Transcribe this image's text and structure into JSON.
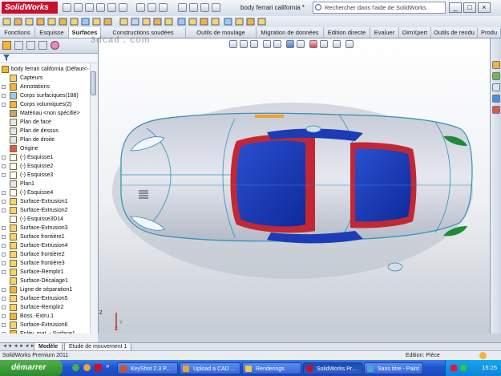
{
  "app": {
    "logo_text": "SolidWorks",
    "document_title": "body ferrari california *",
    "search_placeholder": "Rechercher dans l'aide de SolidWorks",
    "watermark": "3dcad . com",
    "accent_color": "#c8102e"
  },
  "window_buttons": [
    "_",
    "□",
    "×"
  ],
  "command_tabs": [
    {
      "label": "Fonctions",
      "active": false
    },
    {
      "label": "Esquisse",
      "active": false
    },
    {
      "label": "Surfaces",
      "active": true
    },
    {
      "label": "Constructions soudées",
      "active": false
    },
    {
      "label": "Outils de moulage",
      "active": false
    },
    {
      "label": "Migration de données",
      "active": false
    },
    {
      "label": "Edition directe",
      "active": false
    },
    {
      "label": "Evaluer",
      "active": false
    },
    {
      "label": "DimXpert",
      "active": false
    },
    {
      "label": "Outils de rendu",
      "active": false
    },
    {
      "label": "Produ",
      "active": false
    }
  ],
  "feature_tree": {
    "root_label": "body ferrari california  (Défaut<-",
    "items": [
      {
        "label": "Capteurs",
        "icon": "sensor-icon",
        "expandable": false
      },
      {
        "label": "Annotations",
        "icon": "annotation-icon",
        "expandable": true
      },
      {
        "label": "Corps surfaciques(188)",
        "icon": "surface-body-icon",
        "expandable": true
      },
      {
        "label": "Corps volumiques(2)",
        "icon": "solid-body-icon",
        "expandable": true
      },
      {
        "label": "Matériau <non spécifié>",
        "icon": "material-icon",
        "expandable": false
      },
      {
        "label": "Plan de face",
        "icon": "plane-icon",
        "expandable": false
      },
      {
        "label": "Plan de dessus",
        "icon": "plane-icon",
        "expandable": false
      },
      {
        "label": "Plan de droite",
        "icon": "plane-icon",
        "expandable": false
      },
      {
        "label": "Origine",
        "icon": "origin-icon",
        "expandable": false
      },
      {
        "label": "(-) Esquisse1",
        "icon": "sketch-icon",
        "expandable": true
      },
      {
        "label": "(-) Esquisse2",
        "icon": "sketch-icon",
        "expandable": true
      },
      {
        "label": "(-) Esquisse3",
        "icon": "sketch-icon",
        "expandable": true
      },
      {
        "label": "Plan1",
        "icon": "plane-icon",
        "expandable": false
      },
      {
        "label": "(-) Esquisse4",
        "icon": "sketch-icon",
        "expandable": true
      },
      {
        "label": "Surface-Extrusion1",
        "icon": "surface-feature-icon",
        "expandable": true
      },
      {
        "label": "Surface-Extrusion2",
        "icon": "surface-feature-icon",
        "expandable": true
      },
      {
        "label": "(-) Esquisse3D14",
        "icon": "sketch3d-icon",
        "expandable": false
      },
      {
        "label": "Surface-Extrusion3",
        "icon": "surface-feature-icon",
        "expandable": true
      },
      {
        "label": "Surface frontière1",
        "icon": "surface-feature-icon",
        "expandable": true
      },
      {
        "label": "Surface-Extrusion4",
        "icon": "surface-feature-icon",
        "expandable": true
      },
      {
        "label": "Surface frontière2",
        "icon": "surface-feature-icon",
        "expandable": true
      },
      {
        "label": "Surface frontière3",
        "icon": "surface-feature-icon",
        "expandable": true
      },
      {
        "label": "Surface-Remplir1",
        "icon": "surface-feature-icon",
        "expandable": true
      },
      {
        "label": "Surface-Décalage1",
        "icon": "surface-feature-icon",
        "expandable": false
      },
      {
        "label": "Ligne de séparation1",
        "icon": "split-line-icon",
        "expandable": true
      },
      {
        "label": "Surface-Extrusion5",
        "icon": "surface-feature-icon",
        "expandable": true
      },
      {
        "label": "Surface-Remplir2",
        "icon": "surface-feature-icon",
        "expandable": true
      },
      {
        "label": "Boss.-Extru.1",
        "icon": "boss-extrude-icon",
        "expandable": true
      },
      {
        "label": "Surface-Extrusion6",
        "icon": "surface-feature-icon",
        "expandable": true
      },
      {
        "label": "Enlèv. mat. - Surface1",
        "icon": "cut-icon",
        "expandable": true
      }
    ]
  },
  "model_tabs": [
    {
      "label": "Modèle",
      "active": true
    },
    {
      "label": "Etude de mouvement 1",
      "active": false
    }
  ],
  "status": {
    "left": "SolidWorks Premium 2011",
    "right": "Edition: Pièce"
  },
  "taskbar": {
    "start_label": "démarrer",
    "tasks": [
      {
        "label": "KeyShot 2.3 P...",
        "color": "#d94f1f",
        "active": false
      },
      {
        "label": "Upload a CAD ...",
        "color": "#e8a33a",
        "active": false
      },
      {
        "label": "Renderings",
        "color": "#f1c74a",
        "active": false
      },
      {
        "label": "SolidWorks Pr...",
        "color": "#c8102e",
        "active": true
      },
      {
        "label": "Sans titre - Paint",
        "color": "#4aa0e0",
        "active": false
      }
    ],
    "clock": "15:25"
  },
  "triad": {
    "x_label": "X",
    "y_label": "Y",
    "z_label": "Z"
  }
}
